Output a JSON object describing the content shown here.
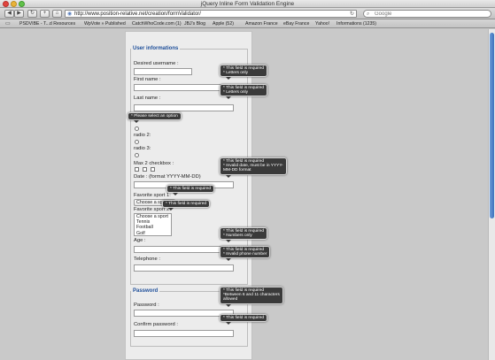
{
  "window": {
    "title": "jQuery Inline Form Validation Engine"
  },
  "toolbar": {
    "url": "http://www.position-relative.net/creation/formValidator/",
    "search_placeholder": "Google",
    "back": "◀",
    "forward": "▶",
    "reload": "↻",
    "add": "+",
    "home": "⌂"
  },
  "bookmarks": [
    "PSDVIBE - T...d Resources",
    "WpVote » Published",
    "CatchWhoCode.com (1)",
    "JBJ's Blog",
    "Apple (52)",
    "Amazon France",
    "eBay France",
    "Yahoo!",
    "Informations (1235)"
  ],
  "form": {
    "section_user": "User informations",
    "desired_username": "Desired username :",
    "first_name": "First name :",
    "last_name": "Last name :",
    "radio2": "radio 2:",
    "radio3": "radio 3:",
    "max2": "Max 2 checkbox :",
    "date": "Date : (format YYYY-MM-DD)",
    "fav1": "Favorite sport 1:",
    "fav1_selected": "Choose a sport",
    "fav2": "Favorite sport 2:",
    "fav2_options": [
      "Choose a sport",
      "Tennis",
      "Football",
      "Golf"
    ],
    "age": "Age :",
    "telephone": "Telephone :",
    "section_password": "Password",
    "password": "Password :",
    "confirm_password": "Confirm password :"
  },
  "errors": {
    "username": [
      "* This field is required",
      "* Letters only"
    ],
    "firstname": [
      "* This field is required",
      "* Letters only"
    ],
    "radio": [
      "* Please select an option"
    ],
    "date": [
      "* This field is required",
      "* Invalid date, must be in YYYY-",
      "MM-DD format"
    ],
    "fav1": [
      "* This field is required"
    ],
    "fav2": [
      "* This field is required"
    ],
    "age": [
      "* This field is required",
      "* Numbers only"
    ],
    "telephone": [
      "* This field is required",
      "* Invalid phone number"
    ],
    "password": [
      "* This field is required",
      "*Between 6 and 11 characters",
      "allowed"
    ],
    "confirm": [
      "* This field is required"
    ]
  }
}
